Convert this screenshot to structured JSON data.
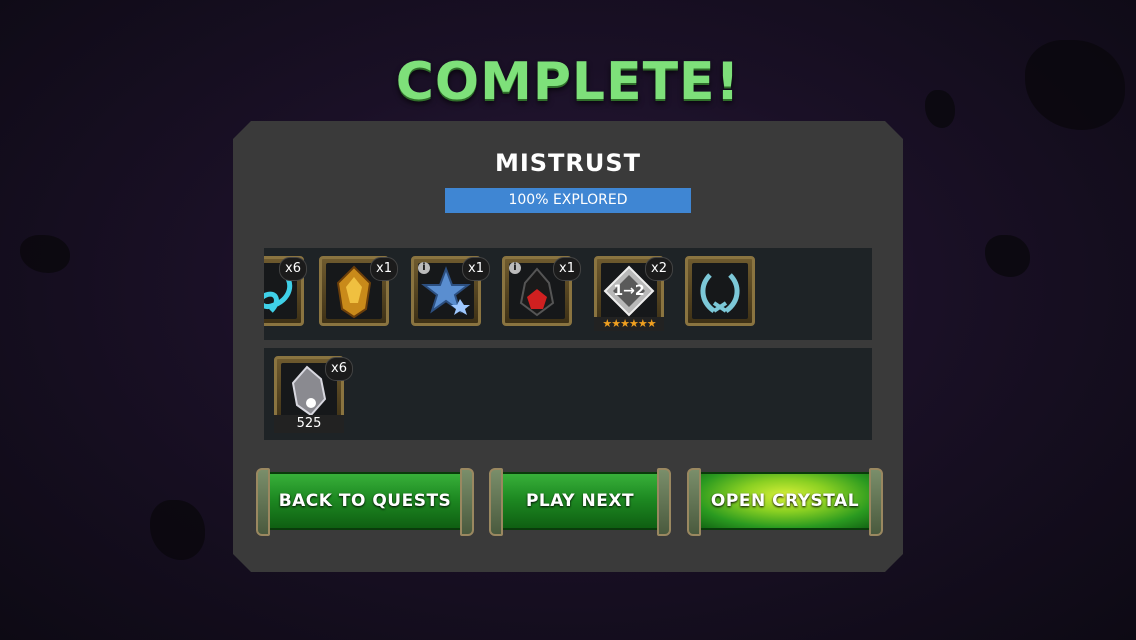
{
  "title": "COMPLETE!",
  "quest": {
    "name": "MISTRUST",
    "progress_percent": 100,
    "progress_label": "100% EXPLORED"
  },
  "rewards_row1": [
    {
      "icon": "blue-swirl-icon",
      "qty": "x6",
      "info": false
    },
    {
      "icon": "gold-crystal-icon",
      "qty": "x1",
      "info": false
    },
    {
      "icon": "blue-star-shard-icon",
      "qty": "x1",
      "info": true
    },
    {
      "icon": "red-crystal-icon",
      "qty": "x1",
      "info": true
    },
    {
      "icon": "rank-up-gem-icon",
      "qty": "x2",
      "info": false,
      "badge": "1→2",
      "stars": 6
    },
    {
      "icon": "laurel-wreath-icon",
      "qty": "",
      "info": false
    }
  ],
  "rewards_row2": [
    {
      "icon": "silver-shard-icon",
      "qty": "x6",
      "count": "525"
    }
  ],
  "buttons": {
    "back": "BACK TO QUESTS",
    "play_next": "PLAY NEXT",
    "open_crystal": "OPEN CRYSTAL"
  },
  "colors": {
    "title_green": "#7ee07a",
    "progress_blue": "#3f86d3",
    "button_green": "#1e8a22",
    "button_glow": "#d8f038"
  }
}
